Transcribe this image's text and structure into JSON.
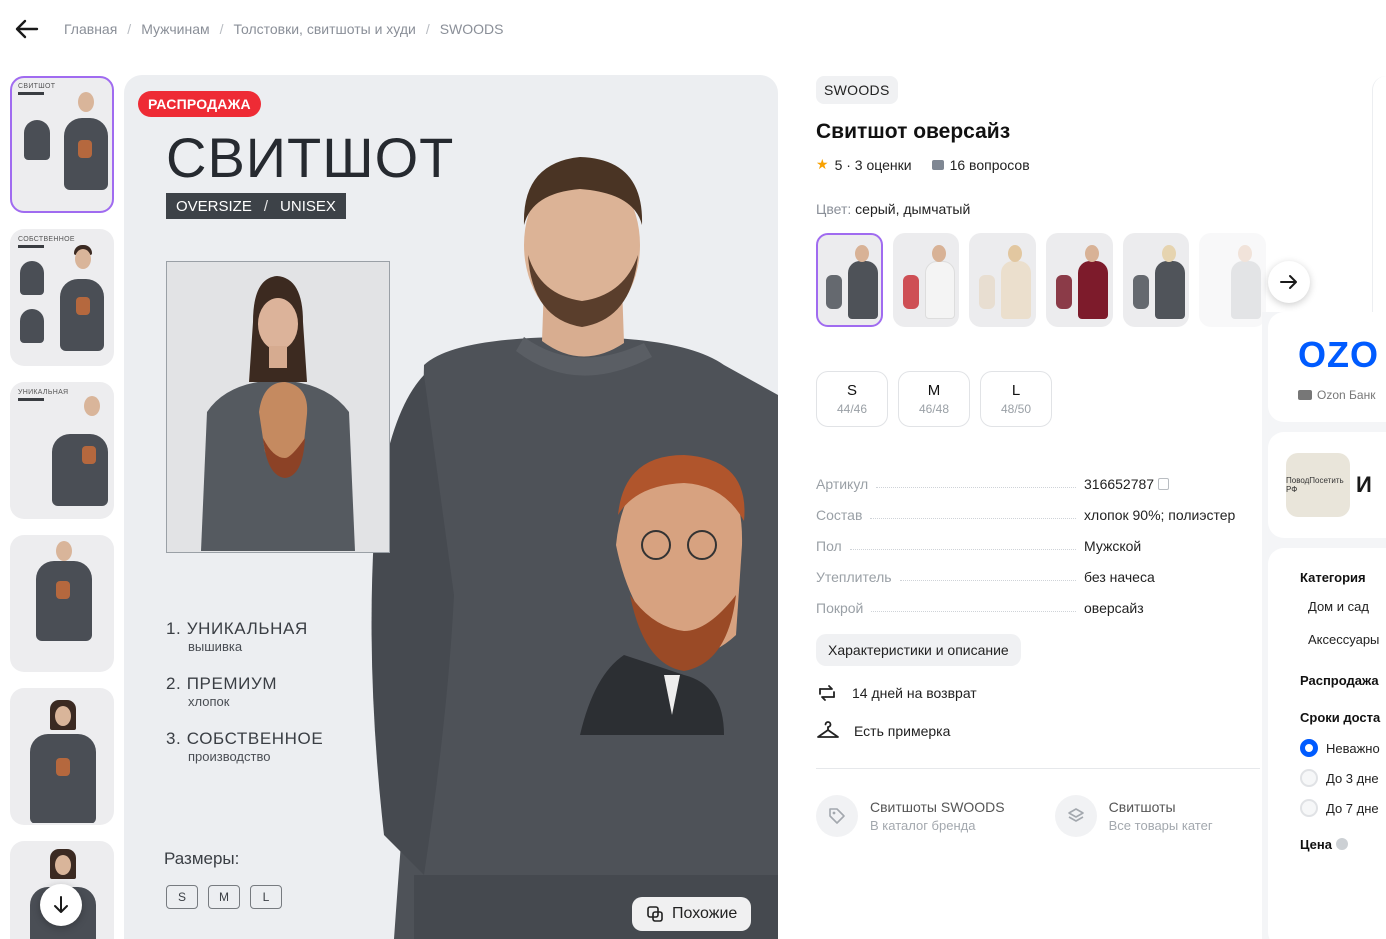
{
  "breadcrumb": {
    "items": [
      "Главная",
      "Мужчинам",
      "Толстовки, свитшоты и худи",
      "SWOODS"
    ],
    "separator": "/"
  },
  "hero": {
    "sale_badge": "РАСПРОДАЖА",
    "title": "СВИТШОТ",
    "tag_left": "OVERSIZE",
    "tag_slash": "/",
    "tag_right": "UNISEX",
    "features": [
      {
        "main": "1.  УНИКАЛЬНАЯ",
        "sub": "вышивка"
      },
      {
        "main": "2.  ПРЕМИУМ",
        "sub": "хлопок"
      },
      {
        "main": "3.  СОБСТВЕННОЕ",
        "sub": "производство"
      }
    ],
    "sizes_heading": "Размеры:",
    "sizes": [
      "S",
      "M",
      "L"
    ],
    "similar_button": "Похожие"
  },
  "thumbnails": {
    "labels": [
      "СВИТШОТ",
      "СОБСТВЕННОЕ",
      "УНИКАЛЬНАЯ",
      "",
      "",
      ""
    ],
    "active_index": 0
  },
  "product": {
    "brand": "SWOODS",
    "title": "Свитшот оверсайз",
    "rating": "5 · 3 оценки",
    "questions": "16 вопросов",
    "color_label": "Цвет:",
    "color_value": "серый, дымчатый",
    "sizes": [
      {
        "size": "S",
        "ru": "44/46"
      },
      {
        "size": "M",
        "ru": "46/48"
      },
      {
        "size": "L",
        "ru": "48/50"
      }
    ],
    "specs": [
      {
        "key": "Артикул",
        "value": "316652787"
      },
      {
        "key": "Состав",
        "value": "хлопок 90%; полиэстер"
      },
      {
        "key": "Пол",
        "value": "Мужской"
      },
      {
        "key": "Утеплитель",
        "value": "без начеса"
      },
      {
        "key": "Покрой",
        "value": "оверсайз"
      }
    ],
    "characteristics_button": "Характеристики и описание",
    "perks": [
      "14 дней на возврат",
      "Есть примерка"
    ],
    "links": [
      {
        "title": "Свитшоты SWOODS",
        "subtitle": "В каталог бренда"
      },
      {
        "title": "Свитшоты",
        "subtitle": "Все товары катег"
      }
    ]
  },
  "ozon_panel": {
    "logo": "OZO",
    "bank": "Ozon Банк",
    "seller_logo_text": "ПоводПосетить РФ",
    "seller_initial": "И",
    "category_heading": "Категория",
    "categories": [
      "Дом и сад",
      "Аксессуары"
    ],
    "sale_heading": "Распродажа",
    "delivery_heading": "Сроки доста",
    "delivery_options": [
      "Неважно",
      "До 3 дне",
      "До 7 дне"
    ],
    "price_heading": "Цена"
  },
  "colors": {
    "accent_purple": "#a06bf0",
    "sale_red": "#ee2b35",
    "ozon_blue": "#005bff",
    "star": "#f8a100"
  }
}
